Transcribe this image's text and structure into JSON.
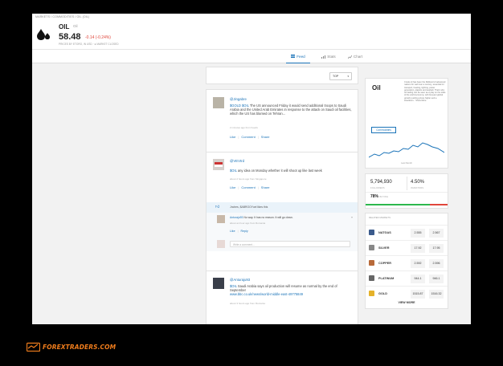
{
  "breadcrumb": "MARKETS / COMMODITIES / OIL (OIL)",
  "asset": {
    "name": "OIL",
    "code": "Oil",
    "price": "58.48",
    "change": "-0.14 (-0.24%)",
    "status": "PRICES BY ETORO, IN USD · ● MARKET CLOSED"
  },
  "tabs": [
    {
      "label": "Feed",
      "icon": "feed-icon",
      "active": true
    },
    {
      "label": "Stats",
      "icon": "stats-icon",
      "active": false
    },
    {
      "label": "Chart",
      "icon": "chart-icon",
      "active": false
    }
  ],
  "feed": {
    "sort_value": "TOP",
    "posts": [
      {
        "user": "@Jingabre",
        "tag": "$GOLD",
        "tag2": "$OIL",
        "text": "The US announced Friday it would send additional troops to Saudi Arabia and the United Arab Emirates in response to the attack on Saudi oil facilities, which the US has blamed on Tehran...",
        "meta": "2 minutes ago from Feeds",
        "actions": [
          "Like",
          "Comment",
          "Share"
        ]
      },
      {
        "user": "@VEVtrd",
        "tag": "$OIL",
        "text": "any idea on Monday whether it will shoot up like last week",
        "meta": "about 2 hours ago from Singapore",
        "actions": [
          "Like",
          "Comment",
          "Share"
        ],
        "likes": "Jnches, $ABROOYuel likes this",
        "reply": {
          "user": "Anturaju93",
          "text": "No way. It has no reason. It will go down.",
          "meta": "about an hour ago from Romania",
          "actions": [
            "Like",
            "Reply"
          ]
        },
        "comment_placeholder": "Write a comment..."
      },
      {
        "user": "@Anturaju93",
        "tag": "$OIL",
        "text": "Saudi Arabia says oil production will resume as normal by the end of September",
        "link": "www.bbc.co.uk/news/world-middle-east-49775849",
        "meta": "about 3 hours ago from Romania",
        "actions": [
          "Like",
          "Comment",
          "Share"
        ]
      }
    ]
  },
  "side": {
    "title": "Oil",
    "description": "Crude oil has been the lifeblood of advanced nations for well over a century, essential for transport, heating, lighting, power generation, plastics and asphalt. That's why oil trading can be seen as a play on the state of the world economy, with buoyant global growth pushing prices higher and a slowdown... Show More",
    "button": "Commodities",
    "chart_caption": "Last Month",
    "followers": "5,794,930",
    "followers_label": "FOLLOWERS",
    "investors": "4.50%",
    "investors_label": "INVESTORS",
    "buying": "78%",
    "buying_label": "BUYING",
    "buying_fraction": 0.78,
    "related_label": "RELATED MARKETS",
    "markets": [
      {
        "name": "NATGAS",
        "sell": "2.555",
        "buy": "2.567",
        "icon": "natgas-icon"
      },
      {
        "name": "SILVER",
        "sell": "17.92",
        "buy": "17.95",
        "icon": "silver-icon"
      },
      {
        "name": "COPPER",
        "sell": "2.592",
        "buy": "2.596",
        "icon": "copper-icon"
      },
      {
        "name": "PLATINUM",
        "sell": "944.1",
        "buy": "946.1",
        "icon": "platinum-icon"
      },
      {
        "name": "GOLD",
        "sell": "1515.87",
        "buy": "1516.32",
        "icon": "gold-icon"
      }
    ],
    "view_more": "VIEW MORE"
  },
  "brand": "FOREXTRADERS.COM",
  "colors": {
    "accent": "#1a73b8",
    "negative": "#e0463b",
    "positive": "#2db84d",
    "brand": "#f07d1c"
  }
}
